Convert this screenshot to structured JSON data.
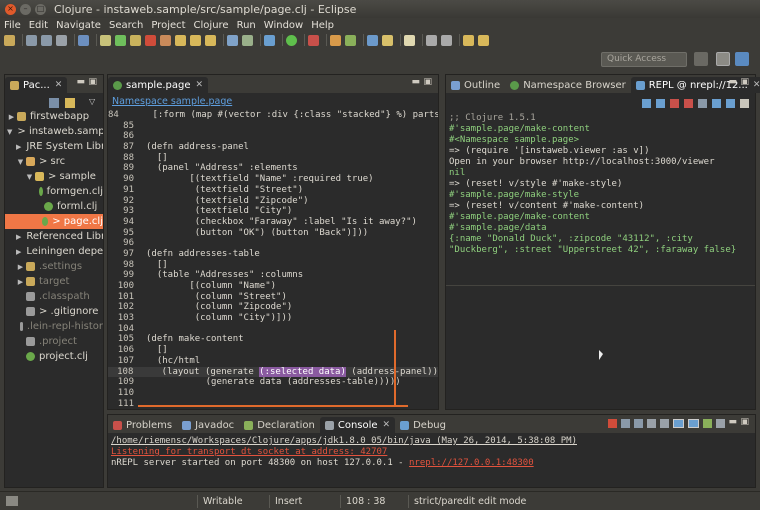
{
  "window": {
    "title": "Clojure - instaweb.sample/src/sample/page.clj - Eclipse"
  },
  "menu": [
    "File",
    "Edit",
    "Navigate",
    "Search",
    "Project",
    "Clojure",
    "Run",
    "Window",
    "Help"
  ],
  "toolbar": {
    "quick_access_placeholder": "Quick Access"
  },
  "explorer": {
    "tab_label": "Pac...",
    "items": [
      {
        "indent": 0,
        "arrow": "▶",
        "icon": "folder-icon",
        "label": "firstwebapp",
        "dim": false
      },
      {
        "indent": 0,
        "arrow": "▼",
        "icon": "project-icon",
        "label": "> instaweb.sample",
        "dim": false
      },
      {
        "indent": 1,
        "arrow": "▶",
        "icon": "library-icon",
        "label": "JRE System Libr",
        "dim": false
      },
      {
        "indent": 1,
        "arrow": "▼",
        "icon": "package-folder-icon",
        "label": "> src",
        "dim": false
      },
      {
        "indent": 2,
        "arrow": "▼",
        "icon": "package-icon",
        "label": "> sample",
        "dim": false
      },
      {
        "indent": 3,
        "arrow": "",
        "icon": "clj-file-icon",
        "label": "formgen.clj",
        "dim": false
      },
      {
        "indent": 3,
        "arrow": "",
        "icon": "clj-file-icon",
        "label": "forml.clj",
        "dim": false
      },
      {
        "indent": 3,
        "arrow": "",
        "icon": "clj-file-icon",
        "label": "> page.clj",
        "dim": false,
        "selected": true
      },
      {
        "indent": 1,
        "arrow": "▶",
        "icon": "library-icon",
        "label": "Referenced Libr",
        "dim": false
      },
      {
        "indent": 1,
        "arrow": "▶",
        "icon": "library-icon",
        "label": "Leiningen deper",
        "dim": false
      },
      {
        "indent": 1,
        "arrow": "▶",
        "icon": "folder-icon",
        "label": ".settings",
        "dim": true
      },
      {
        "indent": 1,
        "arrow": "▶",
        "icon": "folder-icon",
        "label": "target",
        "dim": true
      },
      {
        "indent": 1,
        "arrow": "",
        "icon": "file-icon",
        "label": ".classpath",
        "dim": true
      },
      {
        "indent": 1,
        "arrow": "",
        "icon": "file-icon",
        "label": "> .gitignore",
        "dim": false
      },
      {
        "indent": 1,
        "arrow": "",
        "icon": "file-icon",
        "label": ".lein-repl-histor",
        "dim": true
      },
      {
        "indent": 1,
        "arrow": "",
        "icon": "file-icon",
        "label": ".project",
        "dim": true
      },
      {
        "indent": 1,
        "arrow": "",
        "icon": "clj-file-icon",
        "label": "project.clj",
        "dim": false
      }
    ]
  },
  "editor": {
    "tab_label": "sample.page",
    "breadcrumb": "Namespace sample.page",
    "lines": [
      {
        "n": "84",
        "text": "    [:form (map #(vector :div {:class \"stacked\"} %) parts)]))"
      },
      {
        "n": "85",
        "text": ""
      },
      {
        "n": "86",
        "text": ""
      },
      {
        "n": "87",
        "text": "(defn address-panel"
      },
      {
        "n": "88",
        "text": "  []"
      },
      {
        "n": "89",
        "text": "  (panel \"Address\" :elements"
      },
      {
        "n": "90",
        "text": "        [(textfield \"Name\" :required true)"
      },
      {
        "n": "91",
        "text": "         (textfield \"Street\")"
      },
      {
        "n": "92",
        "text": "         (textfield \"Zipcode\")"
      },
      {
        "n": "93",
        "text": "         (textfield \"City\")"
      },
      {
        "n": "94",
        "text": "         (checkbox \"Faraway\" :label \"Is it away?\")"
      },
      {
        "n": "95",
        "text": "         (button \"OK\") (button \"Back\")]))"
      },
      {
        "n": "96",
        "text": ""
      },
      {
        "n": "97",
        "text": "(defn addresses-table"
      },
      {
        "n": "98",
        "text": "  []"
      },
      {
        "n": "99",
        "text": "  (table \"Addresses\" :columns"
      },
      {
        "n": "100",
        "text": "        [(column \"Name\")"
      },
      {
        "n": "101",
        "text": "         (column \"Street\")"
      },
      {
        "n": "102",
        "text": "         (column \"Zipcode\")"
      },
      {
        "n": "103",
        "text": "         (column \"City\")]))"
      },
      {
        "n": "104",
        "text": ""
      },
      {
        "n": "105",
        "text": "(defn make-content"
      },
      {
        "n": "106",
        "text": "  []"
      },
      {
        "n": "107",
        "text": "  (hc/html"
      },
      {
        "n": "108",
        "text": "   (layout (generate ",
        "sel": "(:selected data)",
        "rest": " (address-panel))"
      },
      {
        "n": "109",
        "text": "           (generate data (addresses-table)))))"
      },
      {
        "n": "110",
        "text": ""
      },
      {
        "n": "111",
        "text": ""
      }
    ]
  },
  "right_panel": {
    "tabs": [
      "Outline",
      "Namespace Browser",
      "REPL @ nrepl://12..."
    ],
    "repl_lines": [
      {
        "cls": "r-gray",
        "text": ";; Clojure 1.5.1"
      },
      {
        "cls": "r-green",
        "text": "#'sample.page/make-content"
      },
      {
        "cls": "r-green",
        "text": "#<Namespace sample.page>"
      },
      {
        "cls": "r-white",
        "text": "=> (require '[instaweb.viewer :as v])"
      },
      {
        "cls": "r-white",
        "text": "Open in your browser http://localhost:3000/viewer"
      },
      {
        "cls": "r-green",
        "text": "nil"
      },
      {
        "cls": "r-white",
        "text": "=> (reset! v/style #'make-style)"
      },
      {
        "cls": "r-green",
        "text": "#'sample.page/make-style"
      },
      {
        "cls": "r-white",
        "text": "=> (reset! v/content #'make-content)"
      },
      {
        "cls": "r-green",
        "text": "#'sample.page/make-content"
      },
      {
        "cls": "r-green",
        "text": "#'sample.page/data"
      },
      {
        "cls": "r-green",
        "text": "{:name \"Donald Duck\", :zipcode \"43112\", :city"
      },
      {
        "cls": "r-green",
        "text": "\"Duckberg\", :street \"Upperstreet 42\", :faraway false}"
      }
    ]
  },
  "bottom_panel": {
    "tabs": [
      "Problems",
      "Javadoc",
      "Declaration",
      "Console",
      "Debug"
    ],
    "active_tab": "Console",
    "console": {
      "path_line": "/home/riemensc/Workspaces/Clojure/apps/jdk1.8.0_05/bin/java (May 26, 2014, 5:38:08 PM)",
      "listening_line": "Listening for transport dt_socket at address: 42707",
      "nrepl_prefix": "nREPL server started on port 48300 on host 127.0.0.1 - ",
      "nrepl_link": "nrepl://127.0.0.1:48300"
    }
  },
  "status": {
    "writable": "Writable",
    "insert": "Insert",
    "position": "108 : 38",
    "mode": "strict/paredit edit mode"
  },
  "colors": {
    "accent": "#f07746",
    "background": "#3c3b37",
    "editor_bg": "#2b2b2b"
  }
}
